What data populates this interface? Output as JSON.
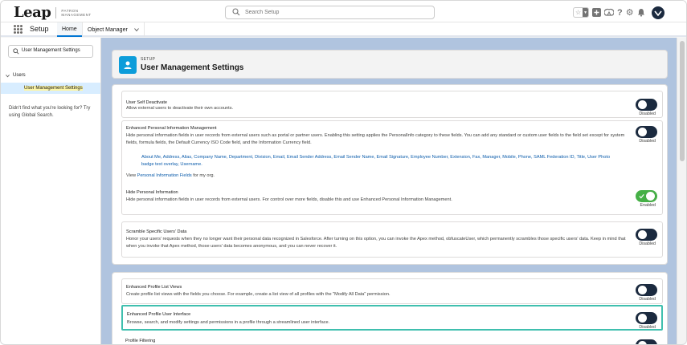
{
  "brand": {
    "logo_text": "Leap",
    "logo_subtitle": "PATRON MANAGEMENT"
  },
  "header": {
    "search_placeholder": "Search Setup"
  },
  "nav": {
    "app_name": "Setup",
    "tabs": [
      {
        "label": "Home",
        "active": true
      },
      {
        "label": "Object Manager",
        "active": false
      }
    ]
  },
  "sidebar": {
    "quick_find_value": "User Management Settings",
    "tree": {
      "group_label": "Users",
      "items": [
        {
          "label": "User Management Settings",
          "selected": true
        }
      ]
    },
    "help_text": "Didn't find what you're looking for? Try using Global Search."
  },
  "page_header": {
    "breadcrumb": "SETUP",
    "title": "User Management Settings"
  },
  "settings_group_1": [
    {
      "title": "User Self Deactivate",
      "description": "Allow external users to deactivate their own accounts.",
      "status": "Disabled",
      "enabled": false
    },
    {
      "title": "Enhanced Personal Information Management",
      "description": "Hide personal information fields in user records from external users such as portal or partner users. Enabling this setting applies the PersonalInfo category to these fields. You can add any standard or custom user fields to the field set except for system fields, formula fields, the Default Currency ISO Code field, and the Information Currency field.",
      "field_list": "About Me, Address, Alias, Company Name, Department, Division, Email, Email Sender Address, Email Sender Name, Email Signature, Employee Number, Extension, Fax, Manager, Mobile, Phone, SAML Federation ID, Title, User Photo badge text overlay, Username.",
      "view_prefix": "View",
      "view_link": "Personal Information Fields",
      "view_suffix": "for my org.",
      "status": "Disabled",
      "enabled": false,
      "sub_title": "Hide Personal Information",
      "sub_description": "Hide personal information fields in user records from external users. For control over more fields, disable this and use Enhanced Personal Information Management.",
      "sub_status": "Enabled",
      "sub_enabled": true
    },
    {
      "title": "Scramble Specific Users' Data",
      "description": "Honor your users' requests when they no longer want their personal data recognized in Salesforce. After turning on this option, you can invoke the Apex method, obfuscateUser, which permanently scrambles those specific users' data. Keep in mind that when you invoke that Apex method, those users' data becomes anonymous, and you can never recover it.",
      "status": "Disabled",
      "enabled": false
    }
  ],
  "settings_group_2": [
    {
      "title": "Enhanced Profile List Views",
      "description": "Create profile list views with the fields you choose. For example, create a list view of all profiles with the \"Modify All Data\" permission.",
      "status": "Disabled",
      "enabled": false
    },
    {
      "title": "Enhanced Profile User Interface",
      "description": "Browse, search, and modify settings and permissions in a profile through a streamlined user interface.",
      "status": "Disabled",
      "enabled": false,
      "highlighted": true
    },
    {
      "title": "Profile Filtering",
      "enabled": false
    }
  ],
  "colors": {
    "toggle_off": "#1b2a3f",
    "toggle_on": "#45b046",
    "highlight_border": "#3fbfae",
    "link": "#0b5cab",
    "setup_badge": "#0d9dda",
    "page_background": "#b0c4df"
  },
  "icons": [
    "search-icon",
    "star-icon",
    "add-icon",
    "trailhead-icon",
    "help-icon",
    "gear-icon",
    "bell-icon",
    "avatar",
    "app-launcher-icon",
    "chevron-down-icon",
    "user-icon",
    "checkmark-icon"
  ]
}
